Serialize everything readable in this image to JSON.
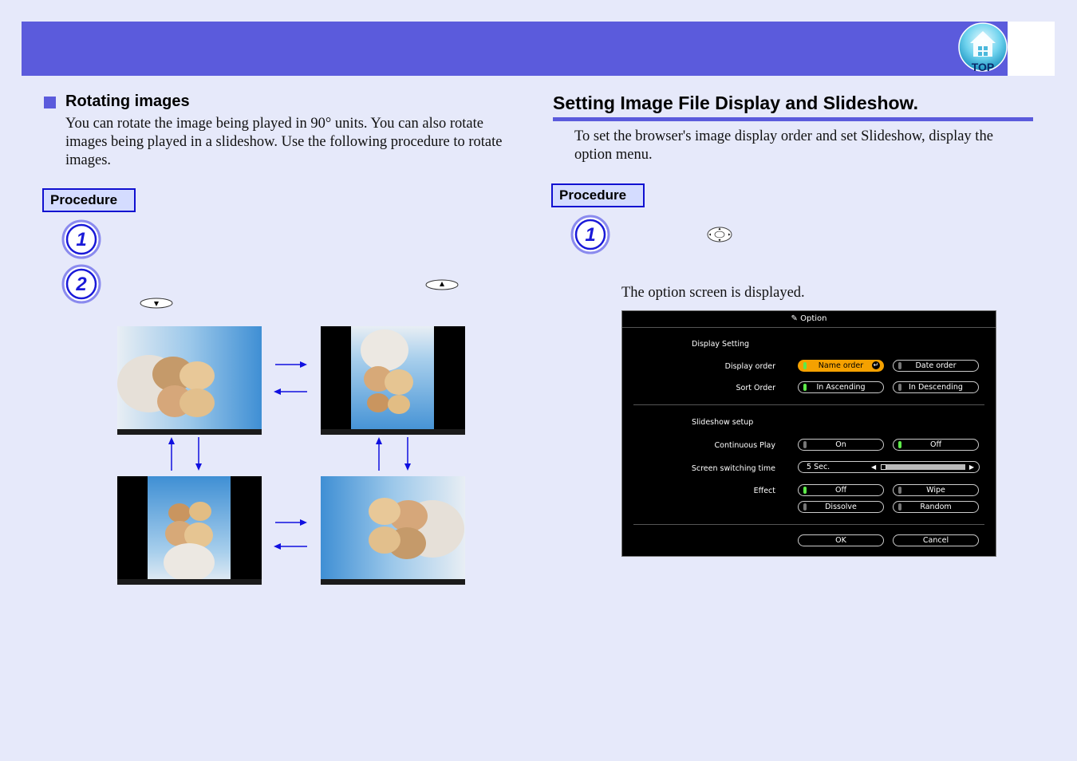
{
  "header": {
    "top_button_label": "TOP"
  },
  "left": {
    "heading": "Rotating images",
    "paragraph": "You can rotate the image being played in 90° units. You can also rotate images being played in a slideshow. Use the following procedure to rotate images.",
    "procedure_label": "Procedure",
    "steps": [
      "1",
      "2"
    ]
  },
  "right": {
    "heading": "Setting Image File Display and Slideshow.",
    "paragraph": "To set the browser's image display order and set Slideshow, display the option menu.",
    "procedure_label": "Procedure",
    "steps": [
      "1"
    ],
    "screen_caption": "The option screen is displayed."
  },
  "option_screen": {
    "title": "Option",
    "display_setting": "Display Setting",
    "display_order_label": "Display order",
    "display_order_options": [
      "Name order",
      "Date order"
    ],
    "sort_order_label": "Sort Order",
    "sort_order_options": [
      "In Ascending",
      "In Descending"
    ],
    "slideshow_setup": "Slideshow setup",
    "continuous_play_label": "Continuous Play",
    "continuous_play_options": [
      "On",
      "Off"
    ],
    "switching_time_label": "Screen switching time",
    "switching_time_value": "5 Sec.",
    "effect_label": "Effect",
    "effect_options": [
      "Off",
      "Wipe",
      "Dissolve",
      "Random"
    ],
    "ok_label": "OK",
    "cancel_label": "Cancel"
  },
  "colors": {
    "accent": "#5b5bdc",
    "selected": "#f5a100",
    "led_on": "#5eea4a"
  }
}
